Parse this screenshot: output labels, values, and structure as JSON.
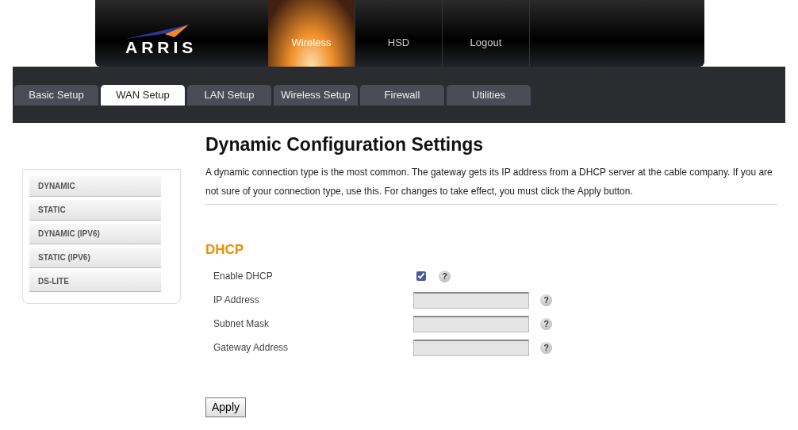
{
  "logo": {
    "text": "ARRIS"
  },
  "main_nav": [
    {
      "label": "Wireless",
      "selected": true
    },
    {
      "label": "HSD",
      "selected": false
    },
    {
      "label": "Logout",
      "selected": false
    }
  ],
  "tabs": [
    {
      "label": "Basic Setup",
      "selected": false
    },
    {
      "label": "WAN Setup",
      "selected": true
    },
    {
      "label": "LAN Setup",
      "selected": false
    },
    {
      "label": "Wireless Setup",
      "selected": false
    },
    {
      "label": "Firewall",
      "selected": false
    },
    {
      "label": "Utilities",
      "selected": false
    }
  ],
  "sidebar": {
    "items": [
      {
        "label": "DYNAMIC"
      },
      {
        "label": "STATIC"
      },
      {
        "label": "DYNAMIC (IPV6)"
      },
      {
        "label": "STATIC (IPV6)"
      },
      {
        "label": "DS-LITE"
      }
    ]
  },
  "page": {
    "title": "Dynamic Configuration Settings",
    "description": "A dynamic connection type is the most common. The gateway gets its IP address from a DHCP server at the cable company. If you are not sure of your connection type, use this. For changes to take effect, you must click the Apply button."
  },
  "section": {
    "title": "DHCP",
    "fields": [
      {
        "kind": "checkbox",
        "label": "Enable DHCP",
        "checked": true,
        "help": "?"
      },
      {
        "kind": "text",
        "label": "IP Address",
        "disabled": true,
        "help": "?"
      },
      {
        "kind": "text",
        "label": "Subnet Mask",
        "disabled": true,
        "help": "?"
      },
      {
        "kind": "text",
        "label": "Gateway Address",
        "disabled": true,
        "help": "?"
      }
    ]
  },
  "apply_button": "Apply"
}
